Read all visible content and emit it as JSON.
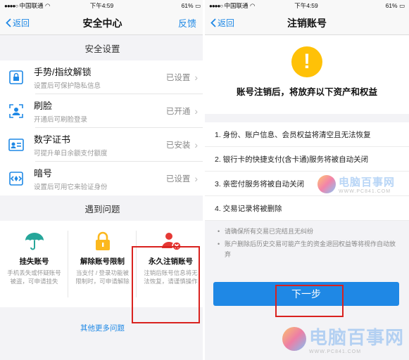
{
  "left": {
    "status": {
      "carrier": "中国联通",
      "time": "下午4:59",
      "battery": "61%"
    },
    "nav": {
      "back": "返回",
      "title": "安全中心",
      "right": "反馈"
    },
    "security_title": "安全设置",
    "items": [
      {
        "title": "手势/指纹解锁",
        "sub": "设置后可保护隐私信息",
        "status": "已设置"
      },
      {
        "title": "刷脸",
        "sub": "开通后可刷脸登录",
        "status": "已开通"
      },
      {
        "title": "数字证书",
        "sub": "可提升单日余额支付额度",
        "status": "已安装"
      },
      {
        "title": "暗号",
        "sub": "设置后可用它来验证身份",
        "status": "已设置"
      }
    ],
    "problems_title": "遇到问题",
    "problems": [
      {
        "title": "挂失账号",
        "sub": "手机丢失或怀疑账号被盗，可申请挂失"
      },
      {
        "title": "解除账号限制",
        "sub": "当支付 / 登录功能被限制时，可申请解除"
      },
      {
        "title": "永久注销账号",
        "sub": "注销后账号信息将无法恢复，请谨慎操作"
      }
    ],
    "more": "其他更多问题"
  },
  "right": {
    "status": {
      "carrier": "中国联通",
      "time": "下午4:59",
      "battery": "61%"
    },
    "nav": {
      "back": "返回",
      "title": "注销账号"
    },
    "warn_icon": "!",
    "warn_text": "账号注销后，将放弃以下资产和权益",
    "items": [
      "1. 身份、账户信息、会员权益将清空且无法恢复",
      "2. 银行卡的快捷支付(含卡通)服务将被自动关闭",
      "3. 亲密付服务将被自动关闭",
      "4. 交易记录将被删除"
    ],
    "notes": [
      "请确保所有交易已完结且无纠纷",
      "账户删除后历史交易可能产生的资金退回权益等将视作自动放弃"
    ],
    "button": "下一步"
  },
  "watermark": {
    "text": "电脑百事网",
    "url": "WWW.PC841.COM"
  },
  "colors": {
    "accent": "#1e88e5",
    "warning": "#ffc107",
    "highlight": "#d9221f",
    "green": "#26a69a",
    "red": "#e53935"
  }
}
